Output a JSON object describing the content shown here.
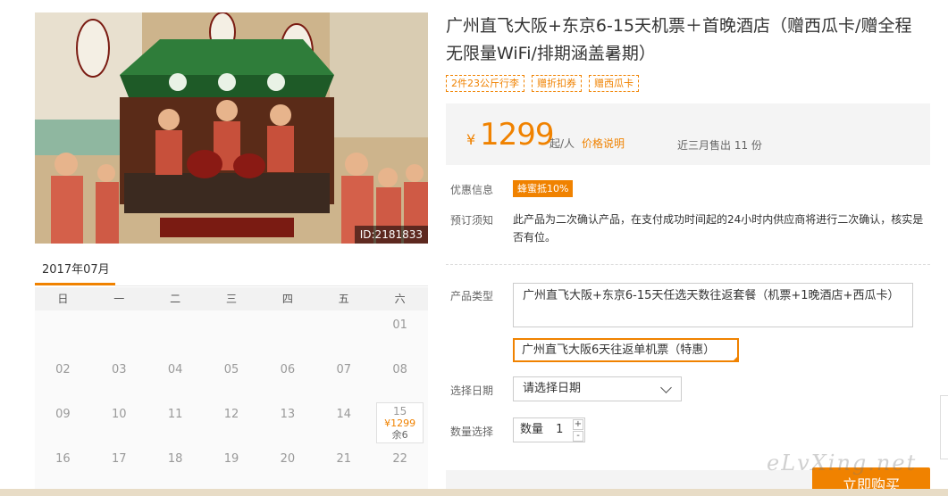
{
  "product": {
    "image_id": "ID:2181833",
    "title": "广州直飞大阪+东京6-15天机票＋首晚酒店（赠西瓜卡/赠全程无限量WiFi/排期涵盖暑期）",
    "tags": [
      "2件23公斤行李",
      "赠折扣券",
      "赠西瓜卡"
    ]
  },
  "price": {
    "symbol": "¥",
    "value": "1299",
    "unit": "起/人",
    "link": "价格说明",
    "sold": "近三月售出 11 份"
  },
  "promo": {
    "label": "优惠信息",
    "badge": "蜂蜜抵10%"
  },
  "notice": {
    "label": "预订须知",
    "text": "此产品为二次确认产品，在支付成功时间起的24小时内供应商将进行二次确认，核实是否有位。"
  },
  "options": {
    "type_label": "产品类型",
    "type_1": "广州直飞大阪+东京6-15天任选天数往返套餐（机票+1晚酒店+西瓜卡）",
    "type_2": "广州直飞大阪6天往返单机票（特惠）",
    "date_label": "选择日期",
    "date_placeholder": "请选择日期",
    "qty_label_row": "数量选择",
    "qty_label": "数量",
    "qty_value": "1",
    "plus": "+",
    "minus": "-"
  },
  "buy_button": "立即购买",
  "watermark": "eLvXing.net",
  "calendar": {
    "month": "2017年07月",
    "weekdays": [
      "日",
      "一",
      "二",
      "三",
      "四",
      "五",
      "六"
    ],
    "weeks": [
      [
        {
          "d": ""
        },
        {
          "d": ""
        },
        {
          "d": ""
        },
        {
          "d": ""
        },
        {
          "d": ""
        },
        {
          "d": ""
        },
        {
          "d": "01"
        }
      ],
      [
        {
          "d": "02"
        },
        {
          "d": "03"
        },
        {
          "d": "04"
        },
        {
          "d": "05"
        },
        {
          "d": "06"
        },
        {
          "d": "07"
        },
        {
          "d": "08"
        }
      ],
      [
        {
          "d": "09"
        },
        {
          "d": "10"
        },
        {
          "d": "11"
        },
        {
          "d": "12"
        },
        {
          "d": "13"
        },
        {
          "d": "14"
        },
        {
          "d": "15",
          "price": "¥1299",
          "stock": "余6"
        }
      ],
      [
        {
          "d": "16"
        },
        {
          "d": "17"
        },
        {
          "d": "18"
        },
        {
          "d": "19"
        },
        {
          "d": "20"
        },
        {
          "d": "21"
        },
        {
          "d": "22"
        }
      ]
    ]
  },
  "colors": {
    "accent": "#f08200"
  }
}
